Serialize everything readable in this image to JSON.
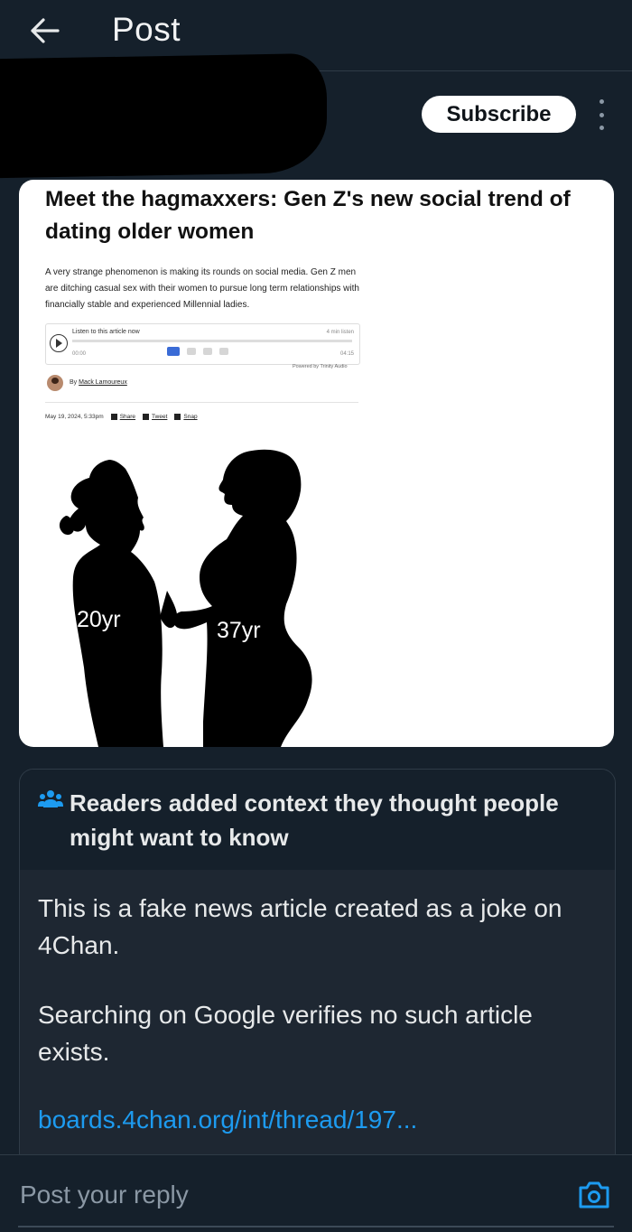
{
  "header": {
    "title": "Post"
  },
  "post": {
    "subscribe_label": "Subscribe",
    "article": {
      "headline": "Meet the hagmaxxers: Gen Z's new social trend of dating older women",
      "lede": "A very strange phenomenon is making its rounds on social media. Gen Z men are ditching casual sex with their women to pursue long term relationships with financially stable and experienced Millennial ladies.",
      "audio_label": "Listen to this article now",
      "audio_duration": "4 min listen",
      "audio_time_start": "00:00",
      "audio_time_end": "04:15",
      "powered_by": "Powered by Trinity Audio",
      "byline_prefix": "By",
      "author": "Mack Lamoureux",
      "date": "May 19, 2024, 5:33pm",
      "share_links": [
        "Share",
        "Tweet",
        "Snap"
      ],
      "labels": [
        "20yr",
        "37yr"
      ]
    }
  },
  "community_note": {
    "title": "Readers added context they thought people might want to know",
    "body": [
      "This is a fake news article created as a joke on 4Chan.",
      "Searching on Google verifies no such article exists."
    ],
    "link": "boards.4chan.org/int/thread/197..."
  },
  "reply": {
    "placeholder": "Post your reply"
  },
  "colors": {
    "background": "#15202b",
    "link": "#1d9bf0",
    "text": "#e7e9ea",
    "muted": "#8b98a5"
  },
  "icons": [
    "back-arrow-icon",
    "more-icon",
    "people-icon",
    "camera-icon"
  ]
}
